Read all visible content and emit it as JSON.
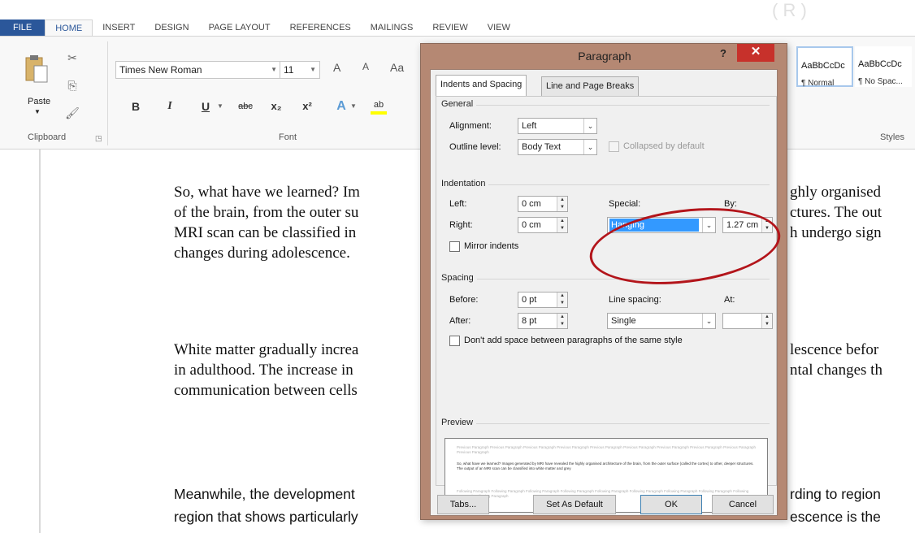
{
  "ribbon_tabs": [
    "FILE",
    "HOME",
    "INSERT",
    "DESIGN",
    "PAGE LAYOUT",
    "REFERENCES",
    "MAILINGS",
    "REVIEW",
    "VIEW"
  ],
  "active_tab": "HOME",
  "clipboard": {
    "paste_label": "Paste",
    "group_label": "Clipboard"
  },
  "font": {
    "family": "Times New Roman",
    "size": "11",
    "group_label": "Font",
    "bold": "B",
    "italic": "I",
    "underline": "U",
    "strikethrough": "abc",
    "subscript": "x₂",
    "superscript": "x²",
    "grow": "A",
    "shrink": "A",
    "effects": "A",
    "highlight": "ab"
  },
  "styles": {
    "group_label": "Styles",
    "items": [
      {
        "sample": "AaBbCcDc",
        "name": "¶ Normal"
      },
      {
        "sample": "AaBbCcDc",
        "name": "¶ No Spac..."
      }
    ]
  },
  "document": {
    "para1": [
      "So, what have we learned? Im",
      "of the brain, from the outer su",
      "MRI scan can be classified in",
      "changes during adolescence."
    ],
    "para1_right": [
      "ghly organised",
      "ctures. The out",
      "h undergo sign",
      ""
    ],
    "para2": [
      "White matter gradually increa",
      "in adulthood. The increase in",
      "communication between cells"
    ],
    "para2_right": [
      "lescence befor",
      "ntal changes th",
      ""
    ],
    "para3": [
      "Meanwhile, the development",
      "region that shows particularly"
    ],
    "para3_right": [
      "rding to region",
      "escence is the"
    ]
  },
  "dialog": {
    "title": "Paragraph",
    "help": "?",
    "close": "✕",
    "tabs": [
      "Indents and Spacing",
      "Line and Page Breaks"
    ],
    "general": {
      "section": "General",
      "alignment_label": "Alignment:",
      "alignment_value": "Left",
      "outline_label": "Outline level:",
      "outline_value": "Body Text",
      "collapsed_label": "Collapsed by default"
    },
    "indentation": {
      "section": "Indentation",
      "left_label": "Left:",
      "left_value": "0 cm",
      "right_label": "Right:",
      "right_value": "0 cm",
      "special_label": "Special:",
      "special_value": "Hanging",
      "by_label": "By:",
      "by_value": "1.27 cm",
      "mirror_label": "Mirror indents"
    },
    "spacing": {
      "section": "Spacing",
      "before_label": "Before:",
      "before_value": "0 pt",
      "after_label": "After:",
      "after_value": "8 pt",
      "line_spacing_label": "Line spacing:",
      "line_spacing_value": "Single",
      "at_label": "At:",
      "at_value": "",
      "dont_add_label": "Don't add space between paragraphs of the same style"
    },
    "preview": {
      "section": "Preview",
      "prev_text": "Previous Paragraph Previous Paragraph Previous Paragraph Previous Paragraph Previous Paragraph Previous Paragraph Previous Paragraph Previous Paragraph Previous Paragraph Previous Paragraph",
      "current_text": "So, what have we learned? Images generated by MRI have revealed the highly organised architecture of the brain, from the outer surface (called the cortex) to other, deeper structures. The output of an MRI scan can be classified into white matter and grey",
      "next_text": "Following Paragraph Following Paragraph Following Paragraph Following Paragraph Following Paragraph Following Paragraph Following Paragraph Following Paragraph Following Paragraph Following Paragraph"
    },
    "buttons": {
      "tabs": "Tabs...",
      "set_default": "Set As Default",
      "ok": "OK",
      "cancel": "Cancel"
    }
  },
  "colors": {
    "file_tab": "#2b579a",
    "dialog_frame": "#b58873",
    "close_button": "#c7312b",
    "annotation": "#b3151b",
    "selection": "#3399ff"
  }
}
